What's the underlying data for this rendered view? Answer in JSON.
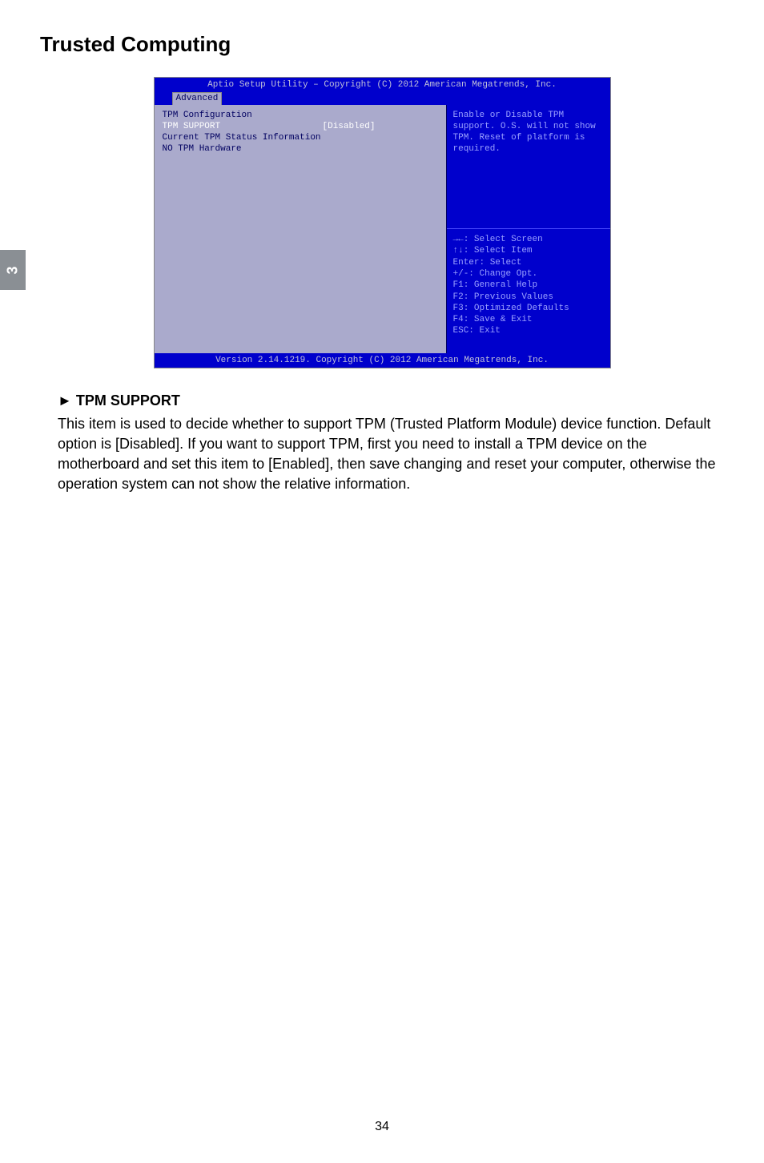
{
  "side_tab": "3",
  "page_title": "Trusted Computing",
  "bios": {
    "header_line": "Aptio Setup Utility – Copyright (C) 2012 American Megatrends, Inc.",
    "active_tab": "Advanced",
    "left": {
      "line1": "TPM Configuration",
      "opt_label": "  TPM SUPPORT",
      "opt_value": "[Disabled]",
      "line_blank": " ",
      "line3": "Current TPM Status Information",
      "line4": "    NO TPM Hardware"
    },
    "right_top": "Enable or Disable TPM\nsupport. O.S. will not show\nTPM. Reset of platform is\nrequired.",
    "right_bottom": "→←: Select Screen\n↑↓: Select Item\nEnter: Select\n+/-: Change Opt.\nF1: General Help\nF2: Previous Values\nF3: Optimized Defaults\nF4: Save & Exit\nESC: Exit",
    "footer": "Version 2.14.1219. Copyright (C) 2012 American Megatrends, Inc."
  },
  "subheading_prefix": "►",
  "subheading_text": "TPM SUPPORT",
  "body_paragraph": "This item is used to decide whether to support TPM (Trusted Platform Module) device function.  Default option is [Disabled]. If you want to support TPM, first you need to install a TPM device on the motherboard and set this item to [Enabled], then save changing and reset your computer, otherwise the operation system can not show the relative information.",
  "page_number": "34"
}
